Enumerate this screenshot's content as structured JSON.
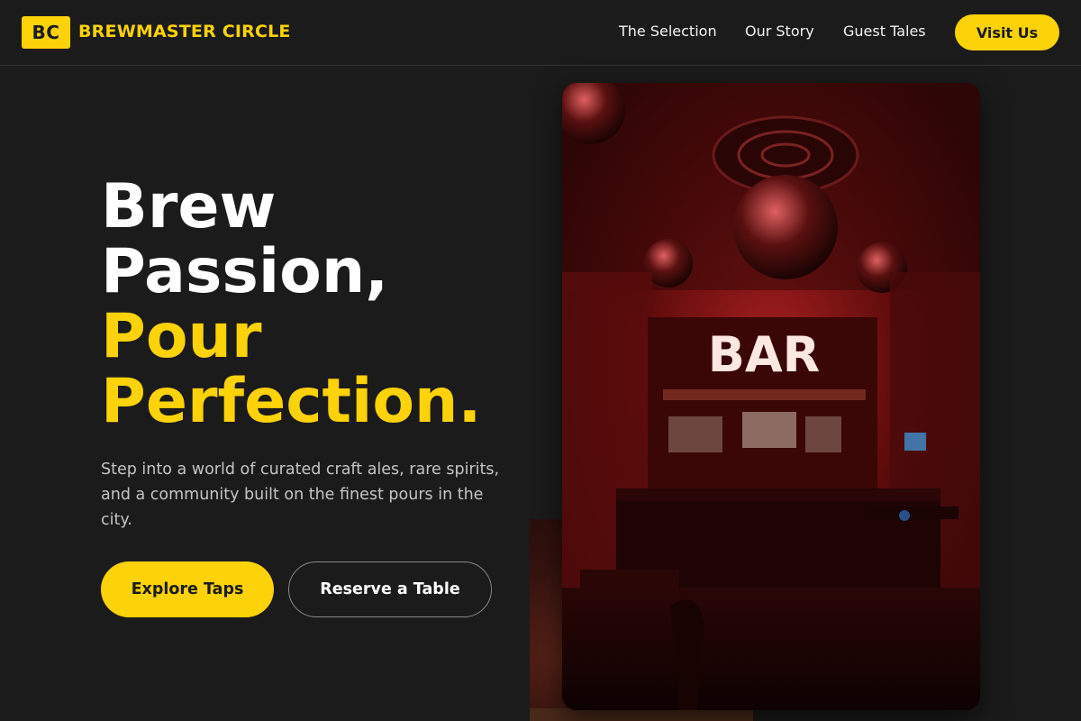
{
  "brand": {
    "badge": "BC",
    "name": "BREWMASTER CIRCLE"
  },
  "nav": {
    "links": [
      "The Selection",
      "Our Story",
      "Guest Tales"
    ],
    "cta": "Visit Us"
  },
  "hero": {
    "headline_white": [
      "Brew",
      "Passion,"
    ],
    "headline_yellow": [
      "Pour",
      "Perfection."
    ],
    "subtext": "Step into a world of curated craft ales, rare spirits, and a community built on the finest pours in the city.",
    "primary_button": "Explore Taps",
    "secondary_button": "Reserve a Table"
  },
  "photo": {
    "sign_text": "BAR"
  },
  "colors": {
    "accent": "#fcd208",
    "background": "#1b1b1b",
    "text_muted": "#c4c4c4"
  }
}
